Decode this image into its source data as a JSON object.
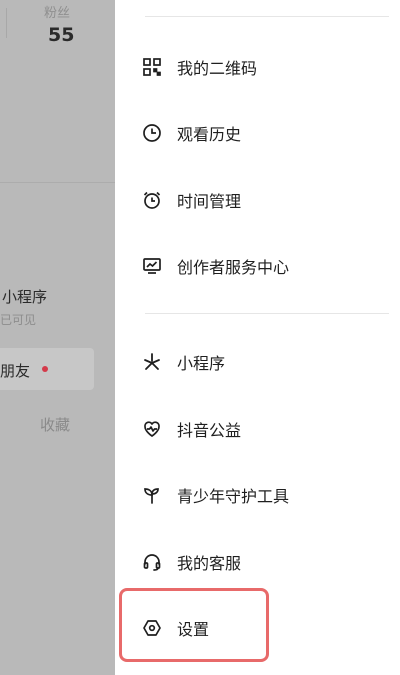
{
  "background_page": {
    "fans_label": "粉丝",
    "fans_count": "55",
    "mini_program_title": "小程序",
    "mini_program_sub": "已可见",
    "friends_label": "朋友",
    "collect_label": "收藏"
  },
  "drawer": {
    "menu": [
      {
        "label": "我的二维码",
        "icon": "qr-code-icon"
      },
      {
        "label": "观看历史",
        "icon": "clock-icon"
      },
      {
        "label": "时间管理",
        "icon": "alarm-clock-icon"
      },
      {
        "label": "创作者服务中心",
        "icon": "monitor-chart-icon"
      },
      {
        "label": "小程序",
        "icon": "asterisk-icon"
      },
      {
        "label": "抖音公益",
        "icon": "heart-pulse-icon"
      },
      {
        "label": "青少年守护工具",
        "icon": "sprout-icon"
      },
      {
        "label": "我的客服",
        "icon": "headset-icon"
      },
      {
        "label": "设置",
        "icon": "hexagon-gear-icon"
      }
    ]
  },
  "colors": {
    "overlay_gray": "#b9b9b9",
    "highlight_red": "#e86a6a",
    "notification_dot": "#d43a4a"
  }
}
